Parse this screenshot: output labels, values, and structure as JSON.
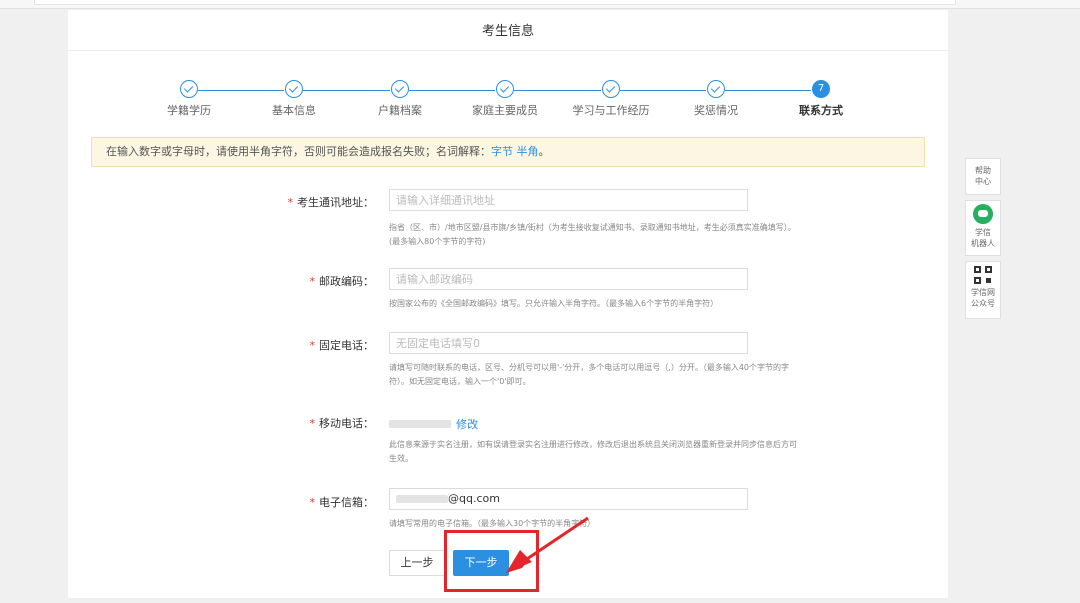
{
  "page": {
    "title": "考生信息"
  },
  "steps": [
    {
      "label": "学籍学历",
      "status": "done"
    },
    {
      "label": "基本信息",
      "status": "done"
    },
    {
      "label": "户籍档案",
      "status": "done"
    },
    {
      "label": "家庭主要成员",
      "status": "done"
    },
    {
      "label": "学习与工作经历",
      "status": "done"
    },
    {
      "label": "奖惩情况",
      "status": "done"
    },
    {
      "label": "联系方式",
      "status": "active",
      "number": "7"
    }
  ],
  "notice": {
    "text": "在输入数字或字母时，请使用半角字符，否则可能会造成报名失败；名词解释：",
    "link1": "字节",
    "link2": "半角",
    "end": "。"
  },
  "form": {
    "address": {
      "label": "考生通讯地址：",
      "placeholder": "请输入详细通讯地址",
      "hint1": "指省（区、市）/地市区盟/县市旗/乡镇/街村（为考生接收复试通知书、录取通知书地址，考生必须真实准确填写）。",
      "hint2": "(最多输入80个字节的字符)"
    },
    "postcode": {
      "label": "邮政编码：",
      "placeholder": "请输入邮政编码",
      "hint": "按国家公布的《全国邮政编码》填写。只允许输入半角字符。（最多输入6个字节的半角字符）"
    },
    "phone": {
      "label": "固定电话：",
      "placeholder": "无固定电话填写0",
      "hint1": "请填写可随时联系的电话，区号、分机号可以用'-'分开，多个电话可以用逗号（,）分开。（最多输入40个字节的字",
      "hint2": "符）。如无固定电话，输入一个'0'即可。"
    },
    "mobile": {
      "label": "移动电话：",
      "edit_link": "修改",
      "hint1": "此信息来源于实名注册，如有误请登录实名注册进行修改，修改后退出系统且关闭浏览器重新登录并同步信息后方可",
      "hint2": "生效。"
    },
    "email": {
      "label": "电子信箱：",
      "value_suffix": "@qq.com",
      "hint": "请填写常用的电子信箱。（最多输入30个字节的半角字符）"
    }
  },
  "buttons": {
    "prev": "上一步",
    "next": "下一步"
  },
  "sidebar": {
    "help": [
      "帮助",
      "中心"
    ],
    "robot": [
      "学信",
      "机器人"
    ],
    "wechat": [
      "学信网",
      "公众号"
    ]
  },
  "colors": {
    "accent": "#2b90e1",
    "highlight": "#e2262b",
    "notice_bg": "#fdf6e3"
  }
}
